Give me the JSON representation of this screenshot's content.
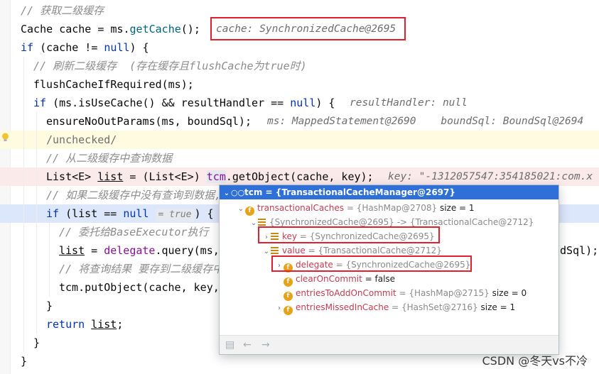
{
  "code_lines": [
    {
      "comment": "// 获取二级缓存"
    },
    {
      "parts": [
        "Cache ",
        "cache",
        " = ",
        "ms",
        ".",
        "getCache",
        "();"
      ],
      "hint": "cache: SynchronizedCache@2695"
    },
    {
      "kw": "if",
      "rest": " (cache != ",
      "null": "null",
      "rest2": ") {"
    },
    {
      "comment": "// 刷新二级缓存  (存在缓存且flushCache为true时)"
    },
    {
      "text": "flushCacheIfRequired(ms);"
    },
    {
      "kw": "if",
      "rest": " (ms.isUseCache() && resultHandler == ",
      "null": "null",
      "rest2": ") {",
      "hint": "resultHandler: null"
    },
    {
      "text": "ensureNoOutParams(ms, boundSql);",
      "hint": "ms: MappedStatement@2690    boundSql: BoundSql@2694"
    },
    {
      "text": "/unchecked/"
    },
    {
      "comment": "// 从二级缓存中查询数据"
    },
    {
      "pre": "List<E> ",
      "var": "list",
      "mid": " = (List<E>) ",
      "tcm": "tcm",
      "post": ".getObject(cache, key);",
      "hint": "key: \"-1312057547:354185021:com.x"
    },
    {
      "comment": "// 如果二级缓存中没有查询到数据,"
    },
    {
      "kw": "if",
      "rest": " (list == ",
      "null": "null",
      "pill": "= true",
      "rest2": ") {"
    },
    {
      "comment": "// 委托给BaseExecutor执行"
    },
    {
      "var": "list",
      "mid": " = ",
      "fld": "delegate",
      "post": ".query(ms,",
      "tail": "dSql);"
    },
    {
      "comment": "// 将查询结果 要存到二级缓存中"
    },
    {
      "text": "tcm.putObject(cache, key,"
    },
    {
      "text": "}"
    },
    {
      "kw": "return",
      "rest": " ",
      "var": "list",
      "rest2": ";"
    },
    {
      "text": "}"
    },
    {
      "text": "}"
    }
  ],
  "popup": {
    "header": {
      "name": "tcm",
      "value": "= {TransactionalCacheManager@2697}"
    },
    "rows": [
      {
        "name": "transactionalCaches",
        "value": "= {HashMap@2708}",
        "extra": "size = 1"
      },
      {
        "name": "{SynchronizedCache@2695} -> {TransactionalCache@2712}",
        "value": "",
        "extra": ""
      },
      {
        "name": "key",
        "value": "= {SynchronizedCache@2695}",
        "extra": ""
      },
      {
        "name": "value",
        "value": "= {TransactionalCache@2712}",
        "extra": ""
      },
      {
        "name": "delegate",
        "value": "= {SynchronizedCache@2695}",
        "extra": ""
      },
      {
        "name": "clearOnCommit",
        "value": "= false",
        "extra": ""
      },
      {
        "name": "entriesToAddOnCommit",
        "value": "= {HashMap@2715}",
        "extra": "size = 0"
      },
      {
        "name": "entriesMissedInCache",
        "value": "= {HashSet@2716}",
        "extra": "size = 1"
      }
    ]
  },
  "watermark": "CSDN @冬天vs不冷",
  "icons": {
    "bulb": "lightbulb-icon",
    "expand": "chevron-right-icon",
    "collapse": "chevron-down-icon",
    "field": "field-f-icon",
    "entry": "map-entry-icon",
    "watch": "watch-glasses-icon"
  },
  "colors": {
    "highlight_box": "#e0202e",
    "popup_header": "#2e6fd8",
    "field_name": "#c13d50",
    "keyword": "#0033b3"
  }
}
